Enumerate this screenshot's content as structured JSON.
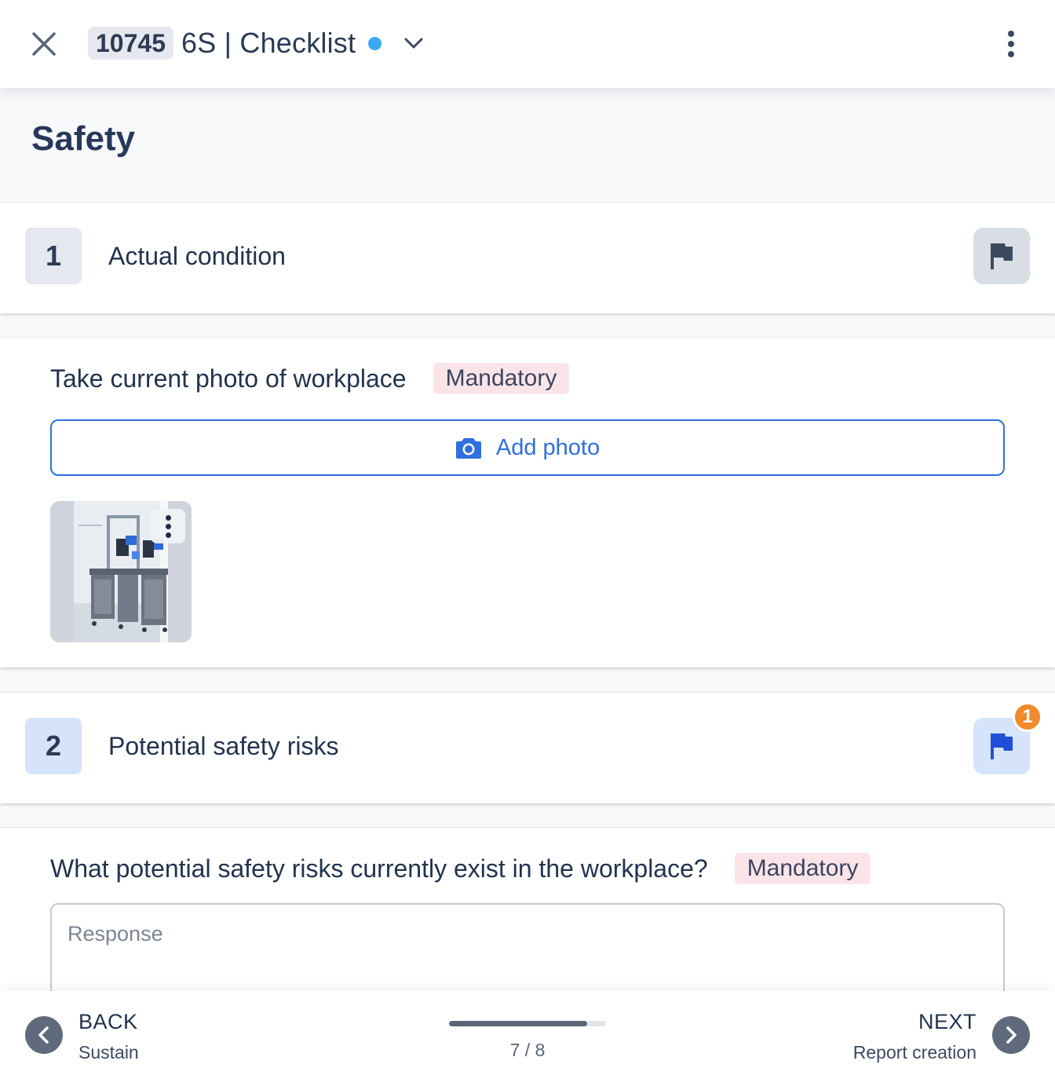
{
  "header": {
    "id_chip": "10745",
    "title": "6S | Checklist",
    "status_color": "#3ba8f5"
  },
  "section": {
    "title": "Safety"
  },
  "categories": [
    {
      "number": "1",
      "label": "Actual condition",
      "flag_count": ""
    },
    {
      "number": "2",
      "label": "Potential safety risks",
      "flag_count": "1"
    }
  ],
  "questions": [
    {
      "text": "Take current photo of workplace",
      "badge": "Mandatory",
      "add_photo_label": "Add photo"
    },
    {
      "text": "What potential safety risks currently exist in the workplace?",
      "badge": "Mandatory",
      "response_placeholder": "Response",
      "response_value": ""
    }
  ],
  "footer": {
    "back_title": "BACK",
    "back_sub": "Sustain",
    "next_title": "NEXT",
    "next_sub": "Report creation",
    "step_current": 7,
    "step_total": 8,
    "step_text": "7 / 8",
    "progress_fraction": 0.88
  },
  "colors": {
    "accent": "#2f6fe0",
    "flag_active": "#1f4fd8",
    "flag_inactive": "#3c4a60",
    "badge": "#f08a2c",
    "mandatory_bg": "#fbe4e8"
  }
}
